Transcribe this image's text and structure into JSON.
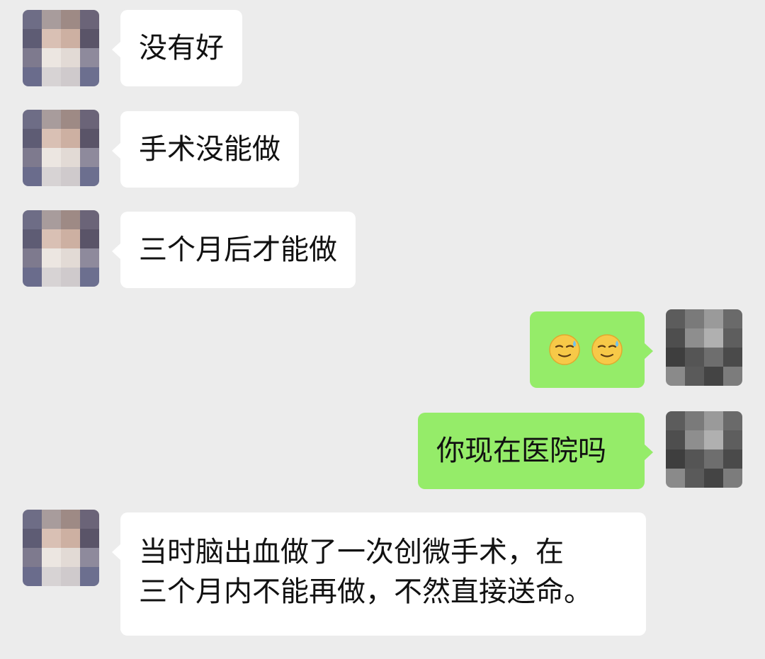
{
  "messages": [
    {
      "side": "left",
      "text": "没有好"
    },
    {
      "side": "left",
      "text": "手术没能做"
    },
    {
      "side": "left",
      "text": "三个月后才能做"
    },
    {
      "side": "right",
      "emoji": [
        "sweat-smile-emoji",
        "sweat-smile-emoji"
      ]
    },
    {
      "side": "right",
      "text": "你现在医院吗"
    },
    {
      "side": "left",
      "lines": [
        "当时脑出血做了一次创微手术，在",
        "三个月内不能再做，不然直接送命。"
      ]
    }
  ],
  "colors": {
    "background": "#ececec",
    "left_bubble": "#ffffff",
    "right_bubble": "#95ec69"
  }
}
